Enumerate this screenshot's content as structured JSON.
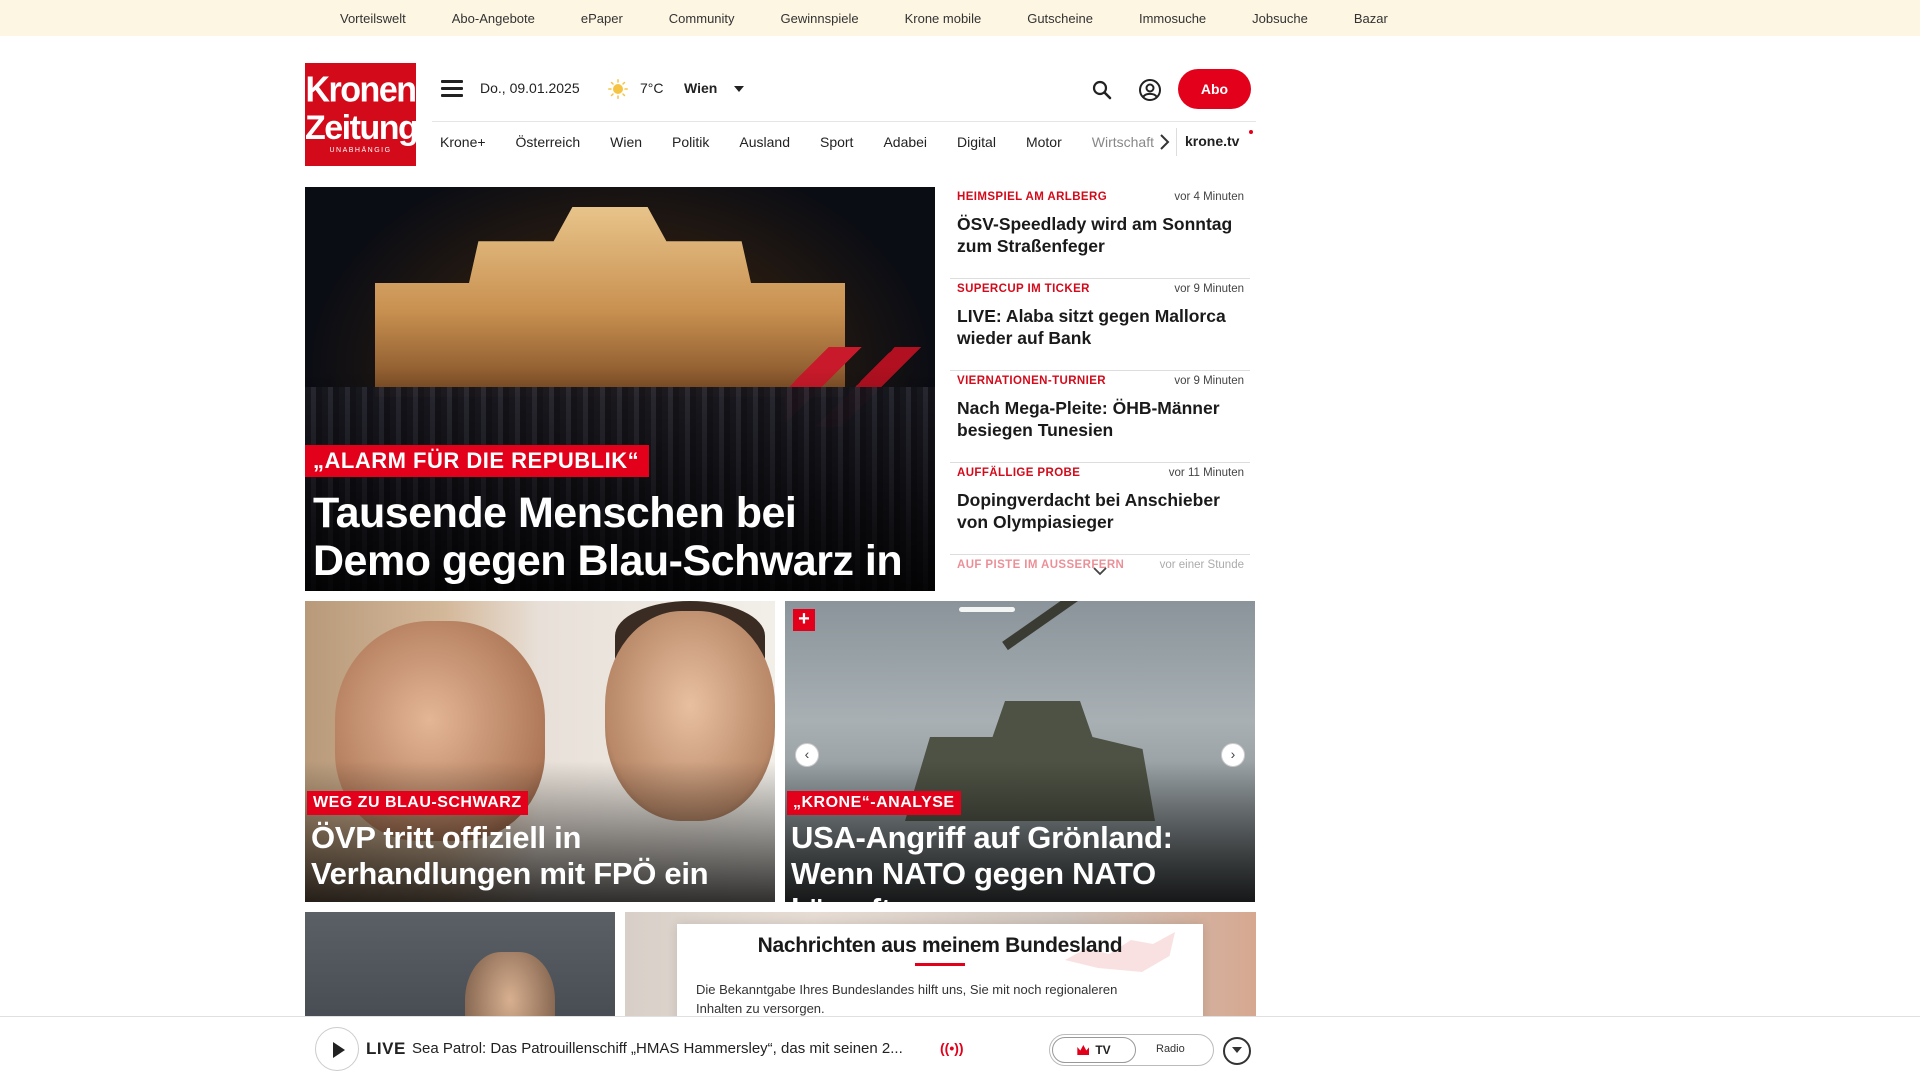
{
  "top_links": [
    "Vorteilswelt",
    "Abo-Angebote",
    "ePaper",
    "Community",
    "Gewinnspiele",
    "Krone mobile",
    "Gutscheine",
    "Immosuche",
    "Jobsuche",
    "Bazar"
  ],
  "logo": {
    "line1": "Kronen",
    "line2": "Zeitung",
    "tagline": "UNABHÄNGIG"
  },
  "header": {
    "date": "Do., 09.01.2025",
    "weather_icon": "sun-icon",
    "temperature": "7°C",
    "city": "Wien",
    "abo_label": "Abo"
  },
  "nav": {
    "items": [
      "Krone+",
      "Österreich",
      "Wien",
      "Politik",
      "Ausland",
      "Sport",
      "Adabei",
      "Digital",
      "Motor",
      "Wirtschaft"
    ],
    "tv_label": "krone.tv"
  },
  "hero": {
    "kicker": "„ALARM FÜR DIE REPUBLIK“",
    "title": "Tausende Menschen bei Demo gegen Blau-Schwarz in Wien"
  },
  "ticker": [
    {
      "kicker": "HEIMSPIEL AM ARLBERG",
      "time": "vor 4 Minuten",
      "title": "ÖSV-Speedlady wird am Sonntag zum Straßenfeger"
    },
    {
      "kicker": "SUPERCUP IM TICKER",
      "time": "vor 9 Minuten",
      "title": "LIVE: Alaba sitzt gegen Mallorca wieder auf Bank"
    },
    {
      "kicker": "VIERNATIONEN-TURNIER",
      "time": "vor 9 Minuten",
      "title": "Nach Mega-Pleite: ÖHB-Männer besiegen Tunesien"
    },
    {
      "kicker": "AUFFÄLLIGE PROBE",
      "time": "vor 11 Minuten",
      "title": "Dopingverdacht bei Anschieber von Olympiasieger"
    },
    {
      "kicker": "AUF PISTE IM AUSSERFERN",
      "time": "vor einer Stunde",
      "title": ""
    }
  ],
  "cards": [
    {
      "kicker": "WEG ZU BLAU-SCHWARZ",
      "title": "ÖVP tritt offiziell in Verhandlungen mit FPÖ ein"
    },
    {
      "kicker": "„KRONE“-ANALYSE",
      "title": "USA-Angriff auf Grönland: Wenn NATO gegen NATO kämpft"
    }
  ],
  "bundesland_dialog": {
    "title": "Nachrichten aus meinem Bundesland",
    "text": "Die Bekanntgabe Ihres Bundeslandes hilft uns, Sie mit noch regionaleren Inhalten zu versorgen."
  },
  "player": {
    "live_label": "LIVE",
    "description": "Sea Patrol: Das Patrouillenschiff „HMAS Hammersley“, das mit seinen 2...",
    "tv_label": "TV",
    "radio_label": "Radio"
  },
  "colors": {
    "brand_red": "#e2001a",
    "topbar_bg": "#fdf6e3"
  }
}
